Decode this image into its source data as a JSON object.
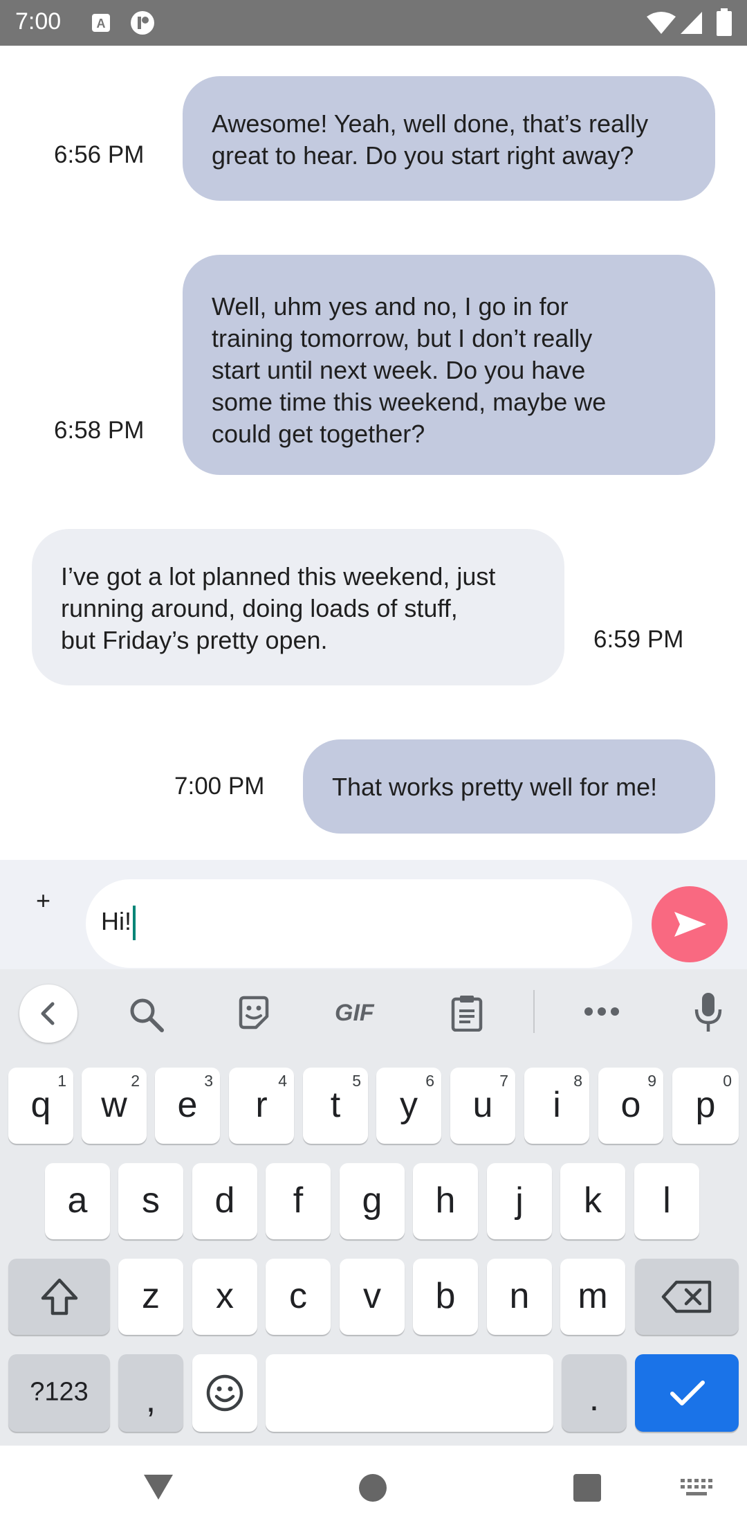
{
  "status_bar": {
    "time": "7:00",
    "icons": [
      "a-badge-icon",
      "app-circle-icon",
      "wifi-icon",
      "cell-signal-icon",
      "battery-icon"
    ]
  },
  "messages": [
    {
      "direction": "sent",
      "time": "6:56 PM",
      "lines": [
        "Awesome! Yeah, well done, that’s really",
        "great to hear. Do you start right away?"
      ]
    },
    {
      "direction": "sent",
      "time": "6:58 PM",
      "lines": [
        "Well, uhm yes and no, I go in for",
        "training tomorrow, but I don’t really",
        "start until next week. Do you have",
        "some time this weekend, maybe we",
        "could get together?"
      ]
    },
    {
      "direction": "received",
      "time": "6:59 PM",
      "lines": [
        "I’ve got a lot planned this weekend, just",
        "running around, doing loads of stuff,",
        "but Friday’s pretty open."
      ]
    },
    {
      "direction": "sent",
      "time": "7:00 PM",
      "lines": [
        "That works pretty well for me!"
      ]
    }
  ],
  "composer": {
    "add_label": "+",
    "input_value": "Hi!",
    "send_icon": "send-arrow-icon"
  },
  "keyboard": {
    "toolbar": [
      "back-chevron-icon",
      "search-icon",
      "sticker-icon",
      "gif-icon",
      "clipboard-icon",
      "more-dots-icon",
      "microphone-icon"
    ],
    "gif_label": "GIF",
    "row1": [
      {
        "key": "q",
        "hint": "1"
      },
      {
        "key": "w",
        "hint": "2"
      },
      {
        "key": "e",
        "hint": "3"
      },
      {
        "key": "r",
        "hint": "4"
      },
      {
        "key": "t",
        "hint": "5"
      },
      {
        "key": "y",
        "hint": "6"
      },
      {
        "key": "u",
        "hint": "7"
      },
      {
        "key": "i",
        "hint": "8"
      },
      {
        "key": "o",
        "hint": "9"
      },
      {
        "key": "p",
        "hint": "0"
      }
    ],
    "row2": [
      "a",
      "s",
      "d",
      "f",
      "g",
      "h",
      "j",
      "k",
      "l"
    ],
    "row3": [
      "z",
      "x",
      "c",
      "v",
      "b",
      "n",
      "m"
    ],
    "symbols_label": "?123",
    "comma_label": ",",
    "period_label": "."
  },
  "colors": {
    "sent_bubble": "#c3cadf",
    "received_bubble": "#eceef3",
    "send_button": "#f96981",
    "enter_key": "#1a73e8",
    "status_bar": "#757575"
  }
}
